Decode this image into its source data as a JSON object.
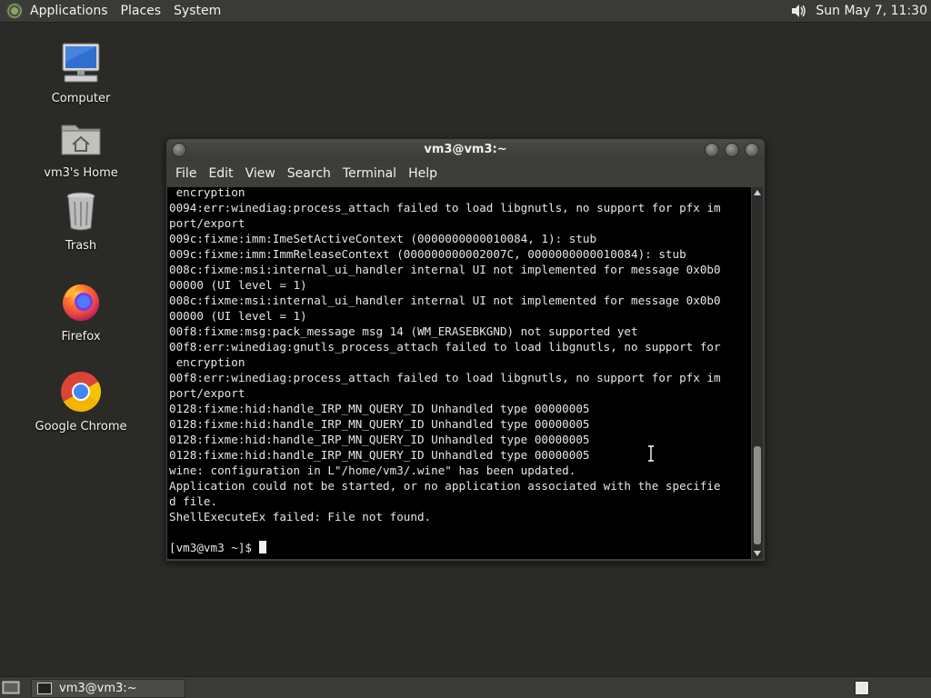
{
  "top_panel": {
    "menus": [
      "Applications",
      "Places",
      "System"
    ],
    "clock": "Sun May  7, 11:30"
  },
  "desktop_icons": [
    {
      "label": "Computer",
      "icon": "computer-icon"
    },
    {
      "label": "vm3's Home",
      "icon": "home-folder-icon"
    },
    {
      "label": "Trash",
      "icon": "trash-icon"
    },
    {
      "label": "Firefox",
      "icon": "firefox-icon"
    },
    {
      "label": "Google Chrome",
      "icon": "chrome-icon"
    }
  ],
  "terminal": {
    "title": "vm3@vm3:~",
    "menu": [
      "File",
      "Edit",
      "View",
      "Search",
      "Terminal",
      "Help"
    ],
    "lines": [
      " encryption",
      "0094:err:winediag:process_attach failed to load libgnutls, no support for pfx im",
      "port/export",
      "009c:fixme:imm:ImeSetActiveContext (0000000000010084, 1): stub",
      "009c:fixme:imm:ImmReleaseContext (000000000002007C, 0000000000010084): stub",
      "008c:fixme:msi:internal_ui_handler internal UI not implemented for message 0x0b0",
      "00000 (UI level = 1)",
      "008c:fixme:msi:internal_ui_handler internal UI not implemented for message 0x0b0",
      "00000 (UI level = 1)",
      "00f8:fixme:msg:pack_message msg 14 (WM_ERASEBKGND) not supported yet",
      "00f8:err:winediag:gnutls_process_attach failed to load libgnutls, no support for",
      " encryption",
      "00f8:err:winediag:process_attach failed to load libgnutls, no support for pfx im",
      "port/export",
      "0128:fixme:hid:handle_IRP_MN_QUERY_ID Unhandled type 00000005",
      "0128:fixme:hid:handle_IRP_MN_QUERY_ID Unhandled type 00000005",
      "0128:fixme:hid:handle_IRP_MN_QUERY_ID Unhandled type 00000005",
      "0128:fixme:hid:handle_IRP_MN_QUERY_ID Unhandled type 00000005",
      "wine: configuration in L\"/home/vm3/.wine\" has been updated.",
      "Application could not be started, or no application associated with the specifie",
      "d file.",
      "ShellExecuteEx failed: File not found.",
      ""
    ],
    "prompt": "[vm3@vm3 ~]$ "
  },
  "taskbar": {
    "task_label": "vm3@vm3:~"
  },
  "colors": {
    "desktop_bg": "#2a2b27",
    "panel_bg": "#3a3b37",
    "terminal_bg": "#000000",
    "terminal_fg": "#e6e6e6"
  }
}
